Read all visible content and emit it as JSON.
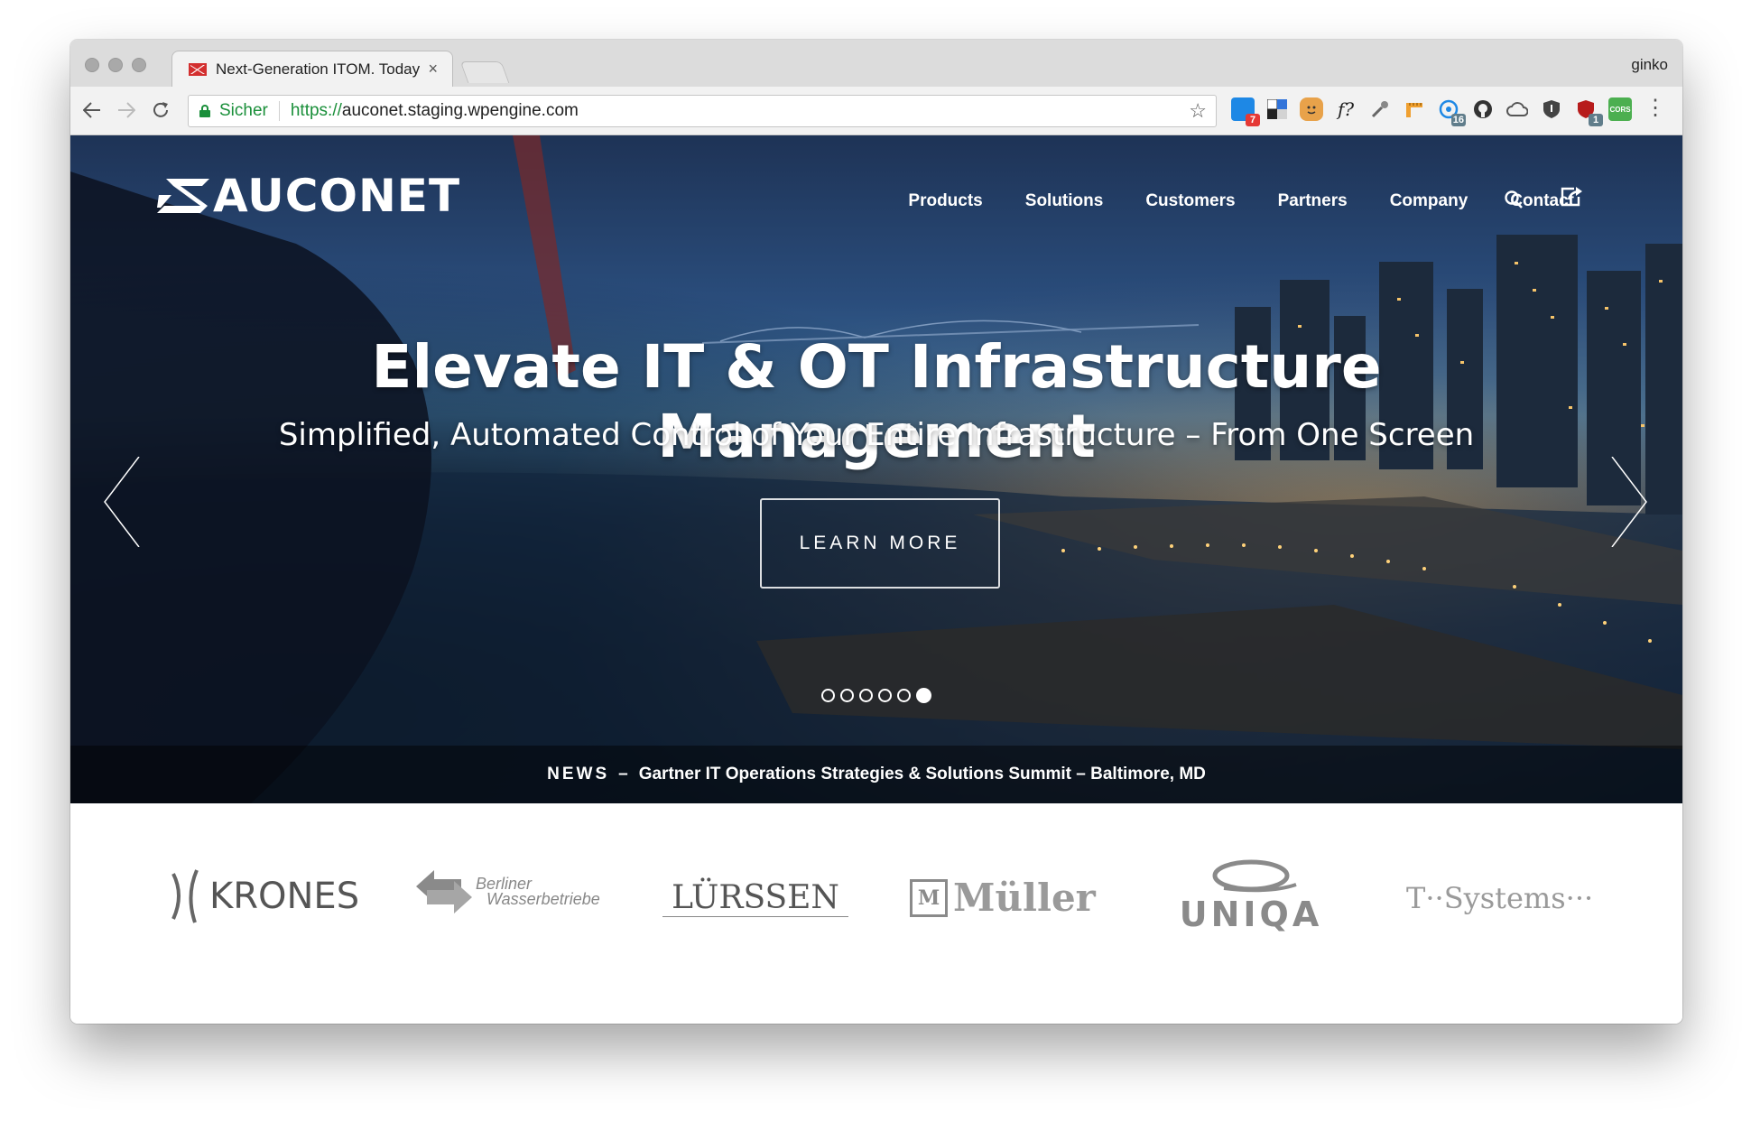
{
  "browser": {
    "tab_title": "Next-Generation ITOM. Today!",
    "tab_close": "×",
    "profile_name": "ginko",
    "secure_label": "Sicher",
    "url_scheme": "https://",
    "url_host": "auconet.staging.wpengine.com",
    "star_icon": "star-icon",
    "extensions": [
      {
        "name": "calendar-extension-icon",
        "color": "#1e88e5",
        "badge": "7",
        "badge_color": "#e53935"
      },
      {
        "name": "delicious-extension-icon",
        "color": "#222222",
        "badge": "",
        "badge_color": ""
      },
      {
        "name": "face-extension-icon",
        "color": "#e8a24a",
        "badge": "",
        "badge_color": ""
      },
      {
        "name": "fontface-extension-icon",
        "color": "#ffffff",
        "badge": "",
        "badge_color": "",
        "glyph": "f?"
      },
      {
        "name": "eyedropper-extension-icon",
        "color": "#ffffff",
        "badge": "",
        "badge_color": ""
      },
      {
        "name": "ruler-extension-icon",
        "color": "#f0a030",
        "badge": "",
        "badge_color": ""
      },
      {
        "name": "network-extension-icon",
        "color": "#1e88e5",
        "badge": "16",
        "badge_color": "#607d8b"
      },
      {
        "name": "github-extension-icon",
        "color": "#333333",
        "badge": "",
        "badge_color": ""
      },
      {
        "name": "cloud-extension-icon",
        "color": "#555555",
        "badge": "",
        "badge_color": ""
      },
      {
        "name": "shield-extension-icon",
        "color": "#444444",
        "badge": "",
        "badge_color": ""
      },
      {
        "name": "ublock-extension-icon",
        "color": "#b71c1c",
        "badge": "1",
        "badge_color": "#607d8b"
      },
      {
        "name": "cors-extension-icon",
        "color": "#4caf50",
        "badge": "",
        "badge_color": "",
        "glyph": "CORS"
      }
    ]
  },
  "site": {
    "logo_text": "AUCONET",
    "nav": [
      {
        "label": "Products",
        "name": "nav-products"
      },
      {
        "label": "Solutions",
        "name": "nav-solutions"
      },
      {
        "label": "Customers",
        "name": "nav-customers"
      },
      {
        "label": "Partners",
        "name": "nav-partners"
      },
      {
        "label": "Company",
        "name": "nav-company"
      },
      {
        "label": "Contact",
        "name": "nav-contact"
      }
    ],
    "hero": {
      "title": "Elevate IT & OT Infrastructure Management",
      "subtitle": "Simplified, Automated Control of Your Entire Infrastructure – From One Screen",
      "cta_label": "LEARN MORE",
      "slide_count": 6,
      "active_slide": 6
    },
    "news": {
      "label": "NEWS",
      "dash": "–",
      "headline": "Gartner IT Operations Strategies & Solutions Summit – Baltimore, MD"
    },
    "clients": {
      "krones": "KRONES",
      "berliner_line1": "Berliner",
      "berliner_line2": "Wasserbetriebe",
      "luerssen": "LÜRSSEN",
      "mueller": "Müller",
      "mueller_mark": "M",
      "uniqa": "UNIQA",
      "tsystems": "T··Systems···"
    }
  },
  "colors": {
    "secure_green": "#1a8f3a",
    "logo_gray": "#777777"
  }
}
